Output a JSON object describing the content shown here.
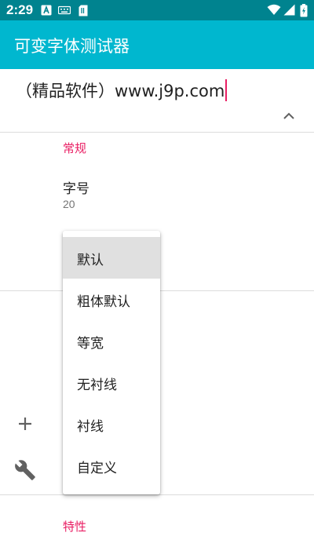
{
  "status_bar": {
    "time": "2:29",
    "icons": [
      "a-notification-icon",
      "keyboard-icon",
      "sd-card-icon",
      "wifi-icon",
      "signal-icon",
      "battery-charging-icon"
    ]
  },
  "app_bar": {
    "title": "可变字体测试器"
  },
  "sample_text": {
    "value": "（精品软件）www.j9p.com"
  },
  "collapse_icon": "chevron-up-icon",
  "sections": {
    "general": {
      "title": "常规",
      "font_size": {
        "title": "字号",
        "value": "20"
      }
    },
    "features": {
      "title": "特性"
    }
  },
  "side_icons": [
    "add-icon",
    "wrench-icon"
  ],
  "font_menu": {
    "selected": "默认",
    "options": [
      "默认",
      "粗体默认",
      "等宽",
      "无衬线",
      "衬线",
      "自定义"
    ]
  },
  "colors": {
    "status_bar": "#00838f",
    "app_bar": "#00b7cf",
    "accent": "#e91e63"
  }
}
